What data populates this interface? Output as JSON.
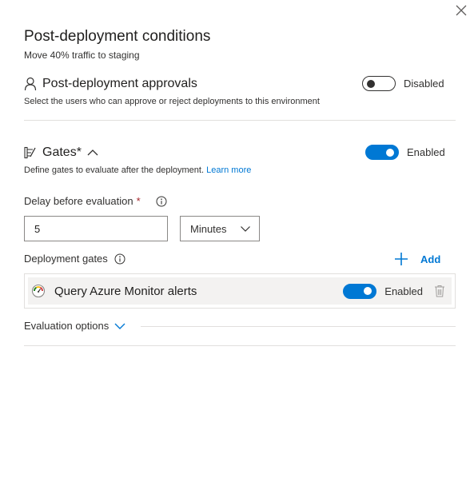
{
  "panel": {
    "title": "Post-deployment conditions",
    "subtitle": "Move 40% traffic to staging"
  },
  "approvals": {
    "title": "Post-deployment approvals",
    "description": "Select the users who can approve or reject deployments to this environment",
    "toggle_state": "off",
    "toggle_label": "Disabled"
  },
  "gates": {
    "title": "Gates*",
    "description": "Define gates to evaluate after the deployment.",
    "learn_more": "Learn more",
    "toggle_state": "on",
    "toggle_label": "Enabled",
    "delay_label": "Delay before evaluation",
    "delay_required_mark": "*",
    "delay_value": "5",
    "delay_unit": "Minutes",
    "deployment_gates_label": "Deployment gates",
    "add_label": "Add",
    "items": [
      {
        "name": "Query Azure Monitor alerts",
        "toggle_state": "on",
        "toggle_label": "Enabled"
      }
    ],
    "evaluation_options_label": "Evaluation options"
  },
  "colors": {
    "accent": "#0078d4",
    "required": "#a4262c",
    "divider": "#e1dfdd",
    "gate_row_bg": "#f3f2f1"
  },
  "icons": [
    "close-icon",
    "person-icon",
    "gates-icon",
    "chevron-up-icon",
    "info-icon",
    "chevron-down-icon",
    "plus-icon",
    "gauge-icon",
    "trash-icon"
  ]
}
